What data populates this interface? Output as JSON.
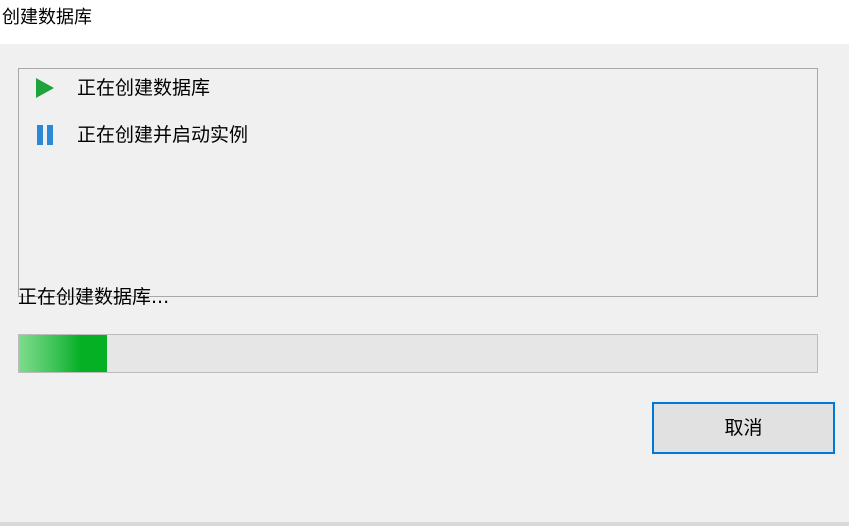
{
  "window": {
    "title": "创建数据库"
  },
  "tasks": [
    {
      "label": "正在创建数据库",
      "icon": "play-icon",
      "state": "running",
      "icon_color": "#1fa33a"
    },
    {
      "label": "正在创建并启动实例",
      "icon": "pause-icon",
      "state": "pending",
      "icon_color": "#2b8ad8"
    }
  ],
  "status": {
    "text": "正在创建数据库..."
  },
  "progress": {
    "fraction": 0.11,
    "fill_color": "#06b025",
    "track_color": "#e6e6e6"
  },
  "buttons": {
    "cancel_label": "取消",
    "cancel_border_color": "#0078d7"
  }
}
